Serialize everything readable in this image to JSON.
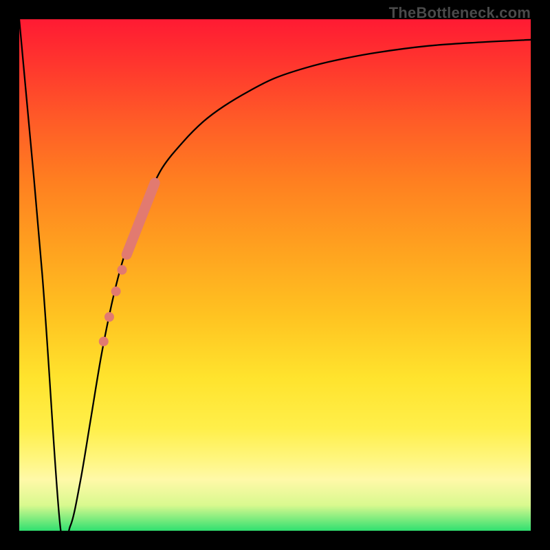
{
  "watermark": "TheBottleneck.com",
  "chart_data": {
    "type": "line",
    "title": "",
    "xlabel": "",
    "ylabel": "",
    "xlim": [
      0,
      100
    ],
    "ylim": [
      0,
      100
    ],
    "series": [
      {
        "name": "bottleneck-curve",
        "x": [
          0,
          4.5,
          8,
          10,
          12,
          14,
          16,
          18,
          20,
          22,
          25,
          28,
          32,
          36,
          40,
          45,
          50,
          56,
          62,
          70,
          80,
          90,
          100
        ],
        "y": [
          100,
          50,
          1,
          1,
          10,
          22,
          34,
          44,
          52,
          58,
          65,
          71,
          76,
          80,
          83,
          86,
          88.5,
          90.5,
          92,
          93.5,
          94.8,
          95.5,
          96
        ]
      }
    ],
    "markers": [
      {
        "name": "segment-thick",
        "kind": "bar",
        "x0": 21.0,
        "y0": 54,
        "x1": 26.5,
        "y1": 68,
        "color": "#e27a70",
        "width": 15
      },
      {
        "name": "dot-1",
        "kind": "dot",
        "x": 20.1,
        "y": 51.0,
        "r": 7,
        "color": "#e27a70"
      },
      {
        "name": "dot-2",
        "kind": "dot",
        "x": 18.9,
        "y": 46.8,
        "r": 7,
        "color": "#e27a70"
      },
      {
        "name": "dot-3",
        "kind": "dot",
        "x": 17.6,
        "y": 41.8,
        "r": 7,
        "color": "#e27a70"
      },
      {
        "name": "dot-4",
        "kind": "dot",
        "x": 16.5,
        "y": 37.0,
        "r": 7,
        "color": "#e27a70"
      }
    ],
    "colors": {
      "curve": "#000000",
      "marker": "#e27a70",
      "gradient_top": "#ff1a33",
      "gradient_bottom": "#30e070"
    }
  }
}
